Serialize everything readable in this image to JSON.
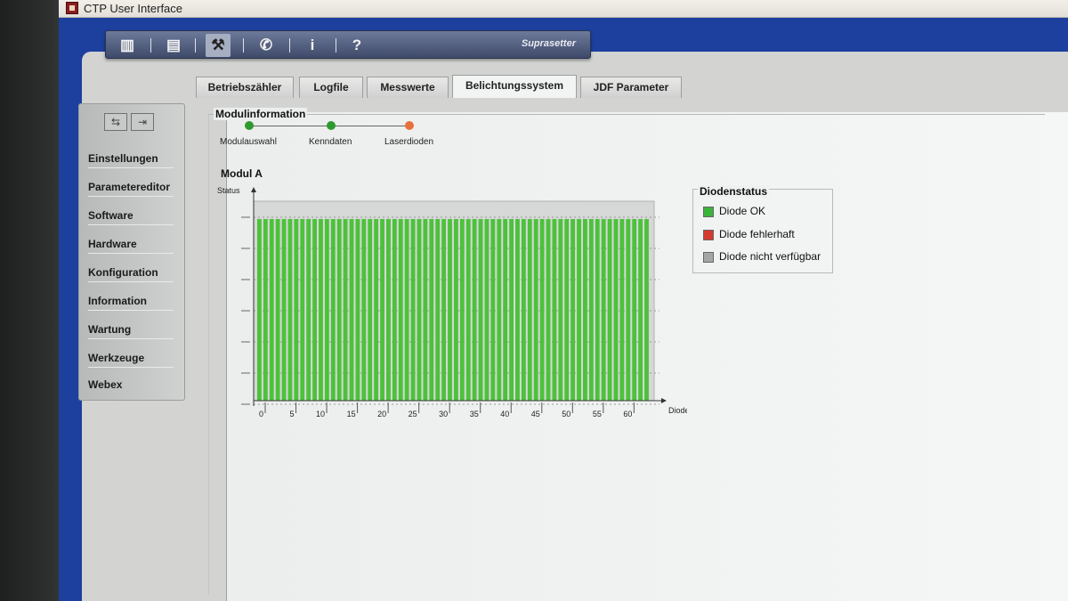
{
  "window": {
    "title": "CTP User Interface"
  },
  "toolbar": {
    "buttons": [
      {
        "icon": "chart-icon",
        "glyph": "▥"
      },
      {
        "icon": "document-icon",
        "glyph": "▤"
      },
      {
        "icon": "wrench-icon",
        "glyph": "⚒"
      },
      {
        "icon": "phone-icon",
        "glyph": "✆"
      },
      {
        "icon": "info-icon",
        "glyph": "i"
      },
      {
        "icon": "help-icon",
        "glyph": "?"
      }
    ],
    "brand": "Suprasetter"
  },
  "sidebar": {
    "items": [
      {
        "label": "Einstellungen"
      },
      {
        "label": "Parametereditor"
      },
      {
        "label": "Software"
      },
      {
        "label": "Hardware"
      },
      {
        "label": "Konfiguration"
      },
      {
        "label": "Information"
      },
      {
        "label": "Wartung"
      },
      {
        "label": "Werkzeuge"
      },
      {
        "label": "Webex"
      }
    ]
  },
  "tabs": [
    {
      "label": "Betriebszähler"
    },
    {
      "label": "Logfile"
    },
    {
      "label": "Messwerte"
    },
    {
      "label": "Belichtungssystem",
      "active": true
    },
    {
      "label": "JDF Parameter"
    }
  ],
  "module_info": {
    "title": "Modulinformation",
    "steps": [
      {
        "label": "Modulauswahl",
        "color": "#2e9a2e"
      },
      {
        "label": "Kenndaten",
        "color": "#2e9a2e"
      },
      {
        "label": "Laserdioden",
        "color": "#e8713a"
      }
    ]
  },
  "modul_title": "Modul A",
  "chart_data": {
    "type": "bar",
    "ylabel": "Status",
    "xlabel": "Dioden",
    "x_ticks": [
      "0",
      "5",
      "10",
      "15",
      "20",
      "25",
      "30",
      "35",
      "40",
      "45",
      "50",
      "55",
      "60"
    ],
    "diode_count": 64,
    "diode_status": "ok",
    "series": [
      {
        "name": "Diode OK",
        "color": "#4cc23a",
        "count": 64
      }
    ]
  },
  "legend": {
    "title": "Diodenstatus",
    "items": [
      {
        "label": "Diode OK",
        "color": "#3ab43a"
      },
      {
        "label": "Diode fehlerhaft",
        "color": "#d63a2e"
      },
      {
        "label": "Diode nicht verfügbar",
        "color": "#a4a6a5"
      }
    ]
  }
}
